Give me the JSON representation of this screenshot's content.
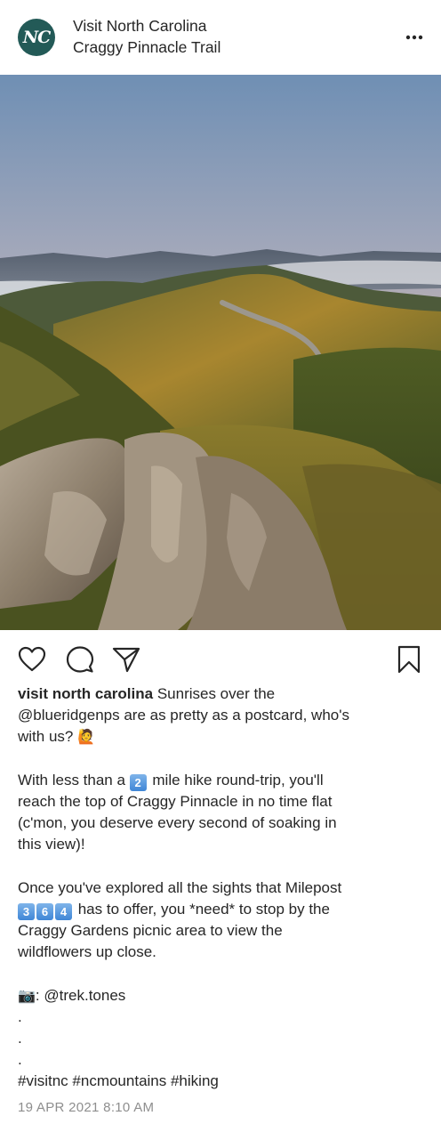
{
  "account": {
    "avatar_initials": "NC",
    "avatar_color": "#235a57",
    "name": "Visit North Carolina",
    "location": "Craggy Pinnacle Trail"
  },
  "icons": {
    "more": "more-horizontal-icon",
    "like": "heart-icon",
    "comment": "comment-icon",
    "share": "share-icon",
    "save": "bookmark-icon"
  },
  "caption": {
    "username": "visit north carolina",
    "p1_l1": " Sunrises over the",
    "p1_l2": "@blueridgenps are as pretty as a postcard, who's",
    "p1_l3": "with us? ",
    "p1_emoji": "🙋",
    "p2_l1_pre": "With less than a ",
    "p2_keycap": "2",
    "p2_l1_post": " mile hike round-trip, you'll",
    "p2_l2": "reach the top of Craggy Pinnacle in no time flat",
    "p2_l3": "(c'mon, you deserve every second of soaking in",
    "p2_l4": "this view)!",
    "p3_l1": "Once you've explored all the sights that Milepost",
    "p3_k1": "3",
    "p3_k2": "6",
    "p3_k3": "4",
    "p3_l2_post": " has to offer, you *need* to stop by the",
    "p3_l3": "Craggy Gardens picnic area to view the",
    "p3_l4": "wildflowers up close.",
    "camera_emoji": "📷",
    "credit": ": @trek.tones",
    "dot1": ".",
    "dot2": ".",
    "dot3": ".",
    "hashtags": "#visitnc #ncmountains #hiking"
  },
  "timestamp": "19 APR 2021 8:10 AM"
}
